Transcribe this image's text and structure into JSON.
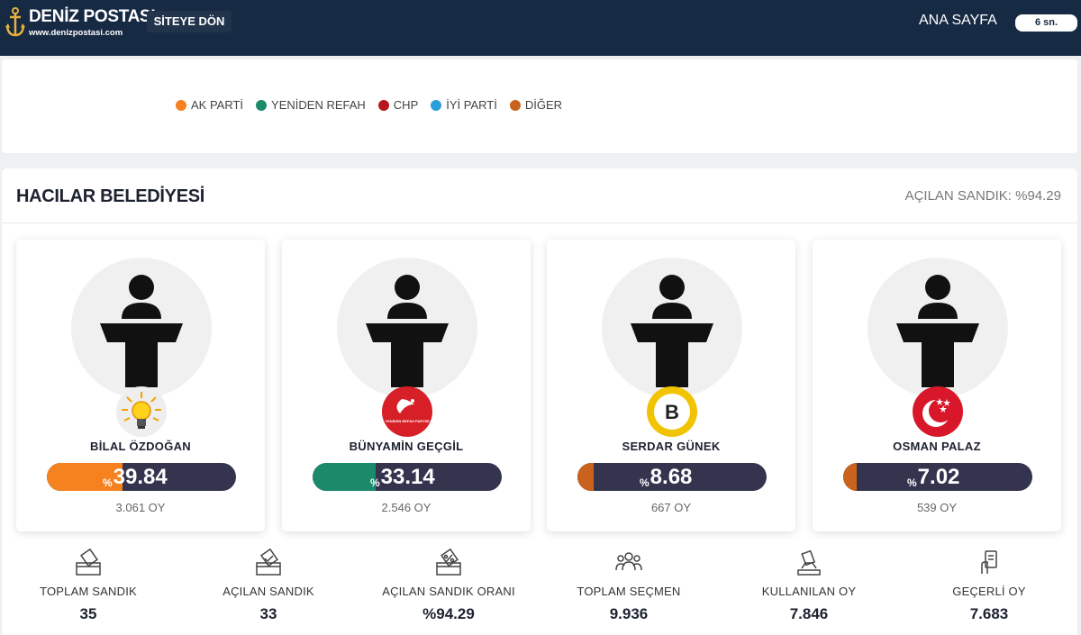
{
  "header": {
    "brand": "DENİZ POSTASI",
    "url": "www.denizpostasi.com",
    "back_label": "SİTEYE DÖN",
    "home_label": "ANA SAYFA",
    "timer": "6 sn."
  },
  "legend": [
    {
      "label": "AK PARTİ",
      "color": "#f5821f"
    },
    {
      "label": "YENİDEN REFAH",
      "color": "#1a8a6b"
    },
    {
      "label": "CHP",
      "color": "#b5161d"
    },
    {
      "label": "İYİ PARTİ",
      "color": "#2aa0d8"
    },
    {
      "label": "DİĞER",
      "color": "#c8621c"
    }
  ],
  "region": {
    "title": "HACILAR BELEDİYESİ",
    "opened": "AÇILAN SANDIK: %94.29"
  },
  "candidates": [
    {
      "name": "BİLAL ÖZDOĞAN",
      "percent_sign": "%",
      "percent": "39.84",
      "votes": "3.061 OY",
      "color": "#f5821f",
      "badge_icon": "ak-parti-bulb-icon"
    },
    {
      "name": "BÜNYAMİN GEÇGİL",
      "percent_sign": "%",
      "percent": "33.14",
      "votes": "2.546 OY",
      "color": "#1a8a6b",
      "badge_icon": "yeniden-refah-logo-icon",
      "badge_text": "YENİDEN REFAH PARTİSİ"
    },
    {
      "name": "SERDAR GÜNEK",
      "percent_sign": "%",
      "percent": "8.68",
      "votes": "667 OY",
      "color": "#c8621c",
      "badge_icon": "b-letter-badge-icon",
      "badge_text": "B"
    },
    {
      "name": "OSMAN PALAZ",
      "percent_sign": "%",
      "percent": "7.02",
      "votes": "539 OY",
      "color": "#c8621c",
      "badge_icon": "crescent-stars-icon"
    }
  ],
  "stats": [
    {
      "label": "TOPLAM SANDIK",
      "value": "35",
      "icon": "ballot-box-icon"
    },
    {
      "label": "AÇILAN SANDIK",
      "value": "33",
      "icon": "ballot-check-icon"
    },
    {
      "label": "AÇILAN SANDIK ORANI",
      "value": "%94.29",
      "icon": "ballot-percent-icon"
    },
    {
      "label": "TOPLAM SEÇMEN",
      "value": "9.936",
      "icon": "people-icon"
    },
    {
      "label": "KULLANILAN OY",
      "value": "7.846",
      "icon": "vote-hand-icon"
    },
    {
      "label": "GEÇERLİ OY",
      "value": "7.683",
      "icon": "valid-vote-icon"
    }
  ]
}
